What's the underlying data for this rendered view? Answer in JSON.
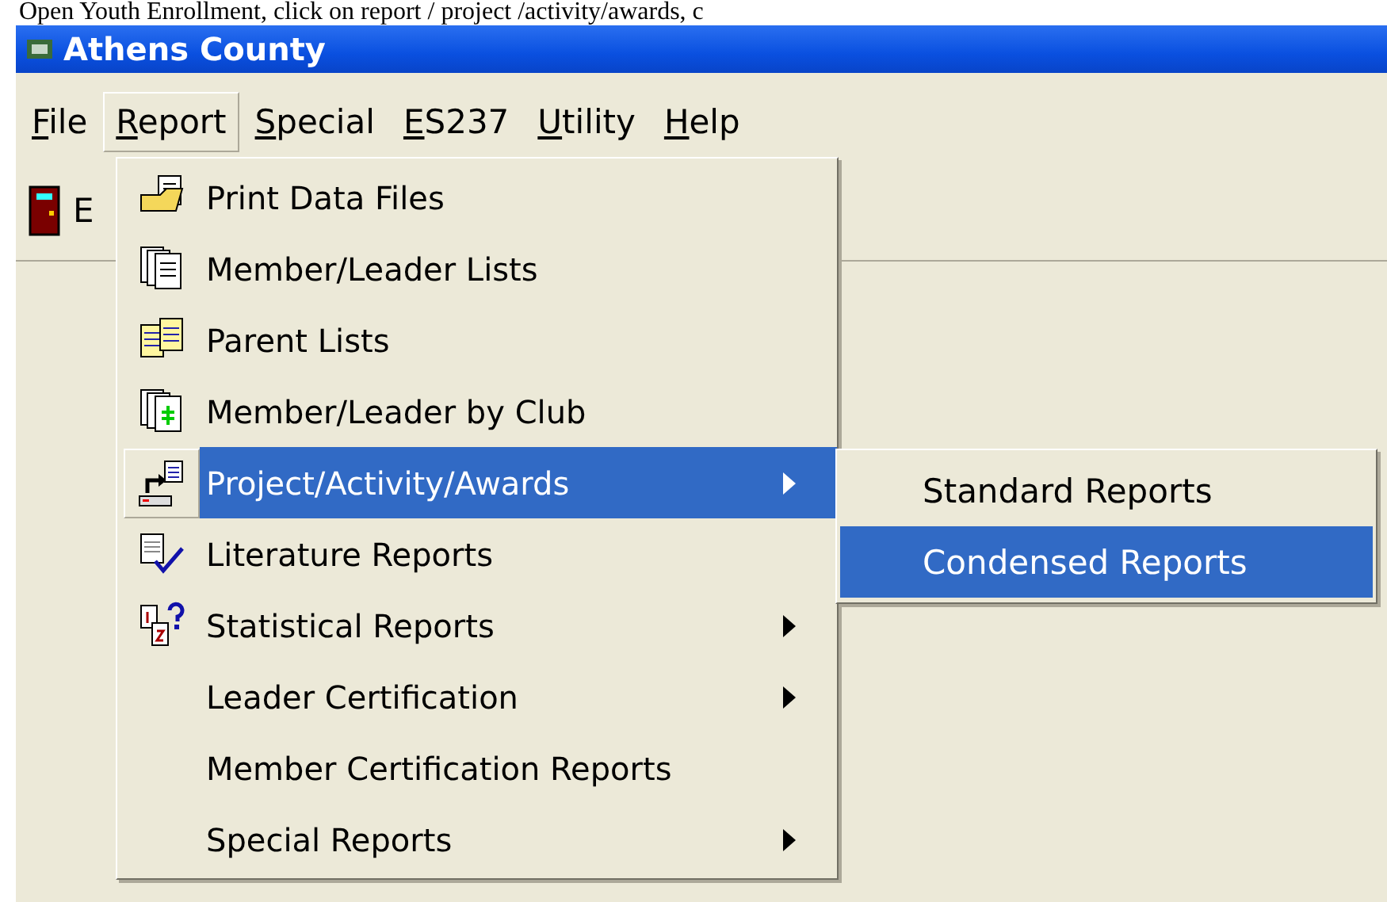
{
  "document_text": "Open Youth Enrollment, click on report / project /activity/awards, c",
  "window": {
    "title": "Athens County"
  },
  "menubar": [
    {
      "label": "File",
      "selected": false
    },
    {
      "label": "Report",
      "selected": true
    },
    {
      "label": "Special",
      "selected": false
    },
    {
      "label": "ES237",
      "selected": false
    },
    {
      "label": "Utility",
      "selected": false
    },
    {
      "label": "Help",
      "selected": false
    }
  ],
  "toolbar": {
    "button_label": "E"
  },
  "report_menu": [
    {
      "label": "Print Data Files",
      "selected": false,
      "submenu": false
    },
    {
      "label": "Member/Leader Lists",
      "selected": false,
      "submenu": false
    },
    {
      "label": "Parent Lists",
      "selected": false,
      "submenu": false
    },
    {
      "label": "Member/Leader by Club",
      "selected": false,
      "submenu": false
    },
    {
      "label": "Project/Activity/Awards",
      "selected": true,
      "submenu": true
    },
    {
      "label": "Literature Reports",
      "selected": false,
      "submenu": false
    },
    {
      "label": "Statistical Reports",
      "selected": false,
      "submenu": true
    },
    {
      "label": "Leader Certification",
      "selected": false,
      "submenu": true
    },
    {
      "label": "Member Certification Reports",
      "selected": false,
      "submenu": false
    },
    {
      "label": "Special Reports",
      "selected": false,
      "submenu": true
    }
  ],
  "submenu": [
    {
      "label": "Standard Reports",
      "selected": false
    },
    {
      "label": "Condensed Reports",
      "selected": true
    }
  ]
}
